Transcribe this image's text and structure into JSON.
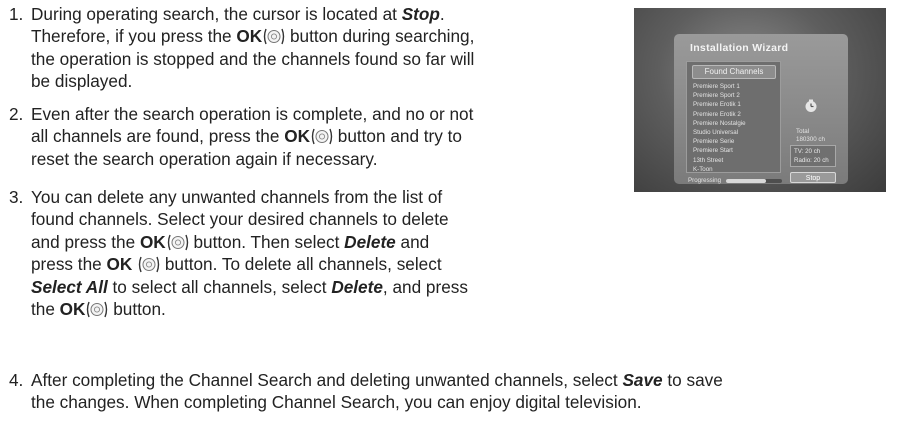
{
  "steps": [
    {
      "number": "1.",
      "lines": [
        [
          {
            "t": "During operating search, the cursor is located at "
          },
          {
            "t": "Stop",
            "s": "bi"
          },
          {
            "t": "."
          }
        ],
        [
          {
            "t": "Therefore, if you press the "
          },
          {
            "t": "OK",
            "s": "b"
          },
          {
            "icon": true
          },
          {
            "t": " button during searching,"
          }
        ],
        [
          {
            "t": "the operation is stopped and the channels found so far will"
          }
        ],
        [
          {
            "t": "be displayed."
          }
        ]
      ]
    },
    {
      "number": "2.",
      "lines": [
        [
          {
            "t": "Even after the search operation is complete, and no or not"
          }
        ],
        [
          {
            "t": "all channels are found, press the "
          },
          {
            "t": "OK",
            "s": "b"
          },
          {
            "icon": true
          },
          {
            "t": " button and try to"
          }
        ],
        [
          {
            "t": "reset the search operation again if necessary."
          }
        ]
      ]
    },
    {
      "number": "3.",
      "lines": [
        [
          {
            "t": "You can delete any unwanted channels from the list of"
          }
        ],
        [
          {
            "t": "found channels. Select your desired channels to delete"
          }
        ],
        [
          {
            "t": "and press the "
          },
          {
            "t": "OK",
            "s": "b"
          },
          {
            "icon": true
          },
          {
            "t": " button. Then select "
          },
          {
            "t": "Delete",
            "s": "bi"
          },
          {
            "t": " and"
          }
        ],
        [
          {
            "t": "press the "
          },
          {
            "t": "OK",
            "s": "b"
          },
          {
            "t": " "
          },
          {
            "icon": true
          },
          {
            "t": " button. To delete all channels, select"
          }
        ],
        [
          {
            "t": "Select All",
            "s": "bi"
          },
          {
            "t": " to select all channels, select "
          },
          {
            "t": "Delete",
            "s": "bi"
          },
          {
            "t": ", and press"
          }
        ],
        [
          {
            "t": "the "
          },
          {
            "t": "OK",
            "s": "b"
          },
          {
            "icon": true
          },
          {
            "t": " button."
          }
        ]
      ]
    },
    {
      "number": "4.",
      "lines": [
        [
          {
            "t": "After completing the Channel Search and deleting unwanted channels, select "
          },
          {
            "t": "Save",
            "s": "bi"
          },
          {
            "t": " to save"
          }
        ],
        [
          {
            "t": "the changes. When completing Channel Search, you can enjoy digital television."
          }
        ]
      ]
    }
  ],
  "tv_screen": {
    "title": "Installation Wizard",
    "list_header": "Found Channels",
    "channels": [
      "Premiere Sport 1",
      "Premiere Sport 2",
      "Premiere Erotik 1",
      "Premiere Erotik 2",
      "Premiere Nostalgie",
      "Studio Universal",
      "Premiere Serie",
      "Premiere Start",
      "13th Street",
      "K-Toon"
    ],
    "total_label": "Total",
    "total_value": "180300 ch",
    "tv_count": "TV: 20 ch",
    "radio_count": "Radio: 20 ch",
    "stop_label": "Stop",
    "progress_label": "Progressing",
    "progress_fraction": 0.72
  },
  "colors": {
    "text": "#222222",
    "tv_background": "#5e5e5e",
    "tv_panel": "#7b7b7b"
  },
  "icons": {
    "ok_button": "ok-button-icon",
    "clock": "clock-icon"
  }
}
